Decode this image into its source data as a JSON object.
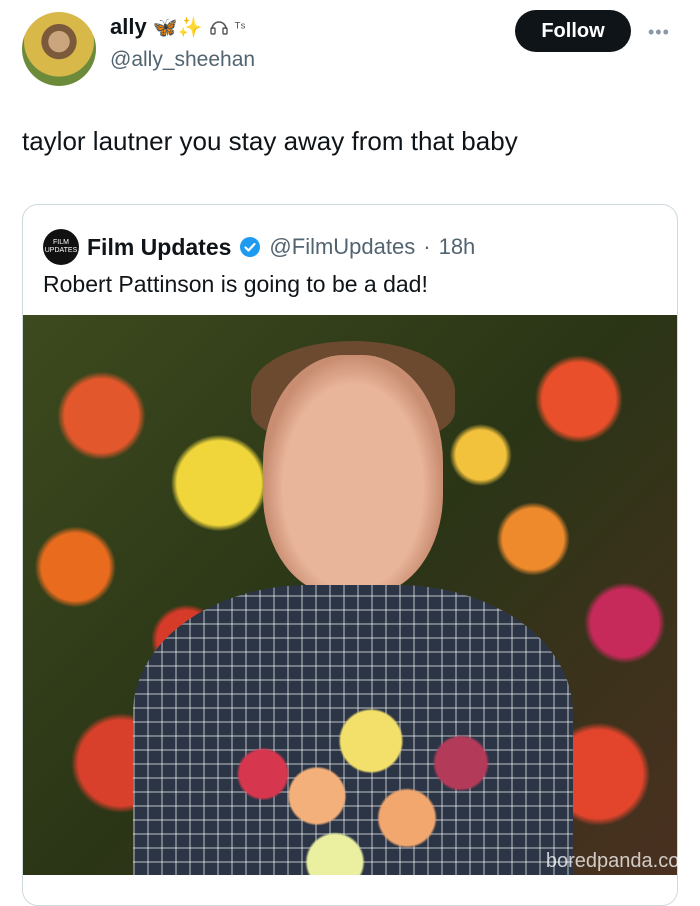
{
  "post": {
    "author_name": "ally",
    "author_emojis": "🦋✨",
    "author_extra": "ᵀˢ",
    "author_handle": "@ally_sheehan",
    "follow_label": "Follow",
    "more_label": "•••",
    "text": "taylor lautner you stay away from that baby"
  },
  "quote": {
    "logo_text": "FILM UPDATES",
    "name": "Film Updates",
    "verified_icon": "verified-badge-icon",
    "handle": "@FilmUpdates",
    "separator": "·",
    "time": "18h",
    "text": "Robert Pattinson is going to be a dad!"
  },
  "watermark": "boredpanda.com",
  "colors": {
    "verified": "#1d9bf0",
    "follow_bg": "#0f1419",
    "secondary_text": "#536471"
  }
}
